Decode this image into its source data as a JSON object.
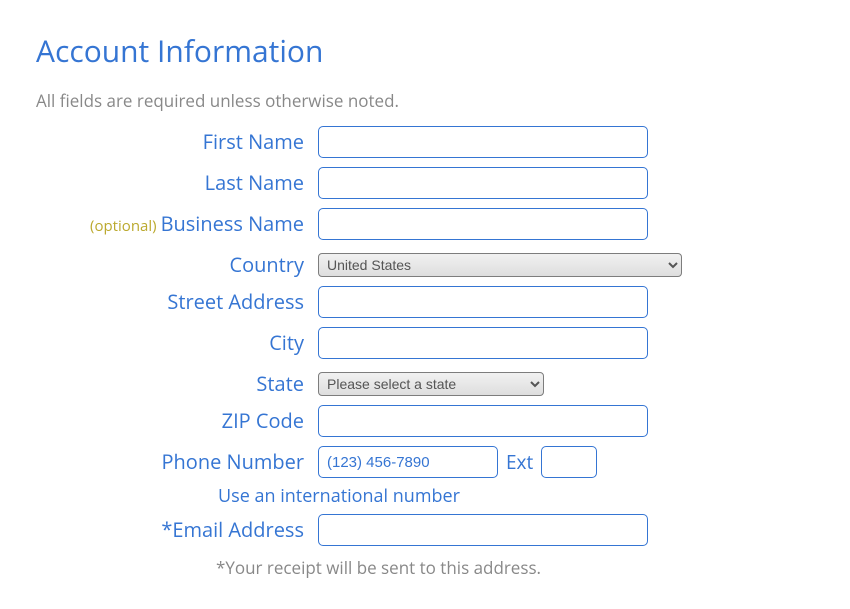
{
  "title": "Account Information",
  "instruction": "All fields are required unless otherwise noted.",
  "optional_tag": "(optional)",
  "labels": {
    "first_name": "First Name",
    "last_name": "Last Name",
    "business_name": "Business Name",
    "country": "Country",
    "street_address": "Street Address",
    "city": "City",
    "state": "State",
    "zip_code": "ZIP Code",
    "phone_number": "Phone Number",
    "ext": "Ext",
    "email_address": "*Email Address"
  },
  "values": {
    "first_name": "",
    "last_name": "",
    "business_name": "",
    "country": "United States",
    "street_address": "",
    "city": "",
    "state": "Please select a state",
    "zip_code": "",
    "phone_number": "",
    "phone_placeholder": "(123) 456-7890",
    "ext": "",
    "email_address": ""
  },
  "intl_link": "Use an international number",
  "receipt_note": "*Your receipt will be sent to this address."
}
